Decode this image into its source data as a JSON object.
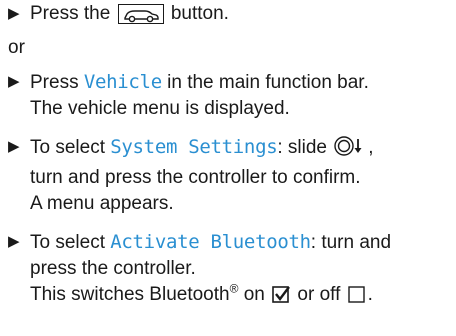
{
  "step1": {
    "bullet": "▶",
    "before": "Press the",
    "button_icon": "vehicle-button-icon",
    "after": "button."
  },
  "or_text": "or",
  "step2": {
    "bullet": "▶",
    "before": "Press ",
    "keyword": "Vehicle",
    "after": " in the main function bar.",
    "line2": "The vehicle menu is displayed."
  },
  "step3": {
    "bullet": "▶",
    "before": "To select ",
    "keyword": "System Settings",
    "after": ": slide",
    "after_icon": ",",
    "line2": "turn and press the controller to confirm.",
    "line3": "A menu appears."
  },
  "step4": {
    "bullet": "▶",
    "before": "To select ",
    "keyword": "Activate Bluetooth",
    "after": ": turn and",
    "line2": "press the controller.",
    "line3_a": "This switches Bluetooth",
    "line3_sup": "®",
    "line3_b": " on ",
    "line3_c": " or off ",
    "line3_d": "."
  },
  "colors": {
    "keyword": "#2a8fd1",
    "text": "#1a1a1a"
  }
}
